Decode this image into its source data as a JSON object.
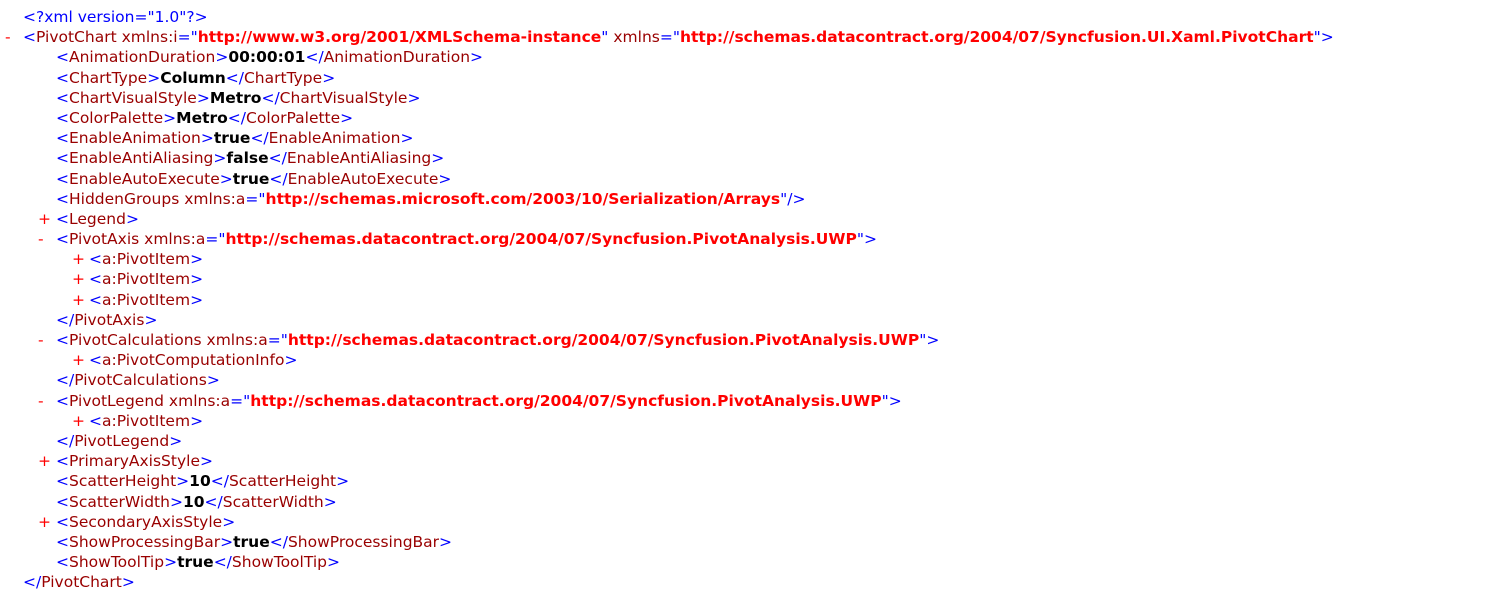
{
  "declaration": "<?xml version=\"1.0\"?>",
  "symbols": {
    "collapse": "-",
    "expand": "+"
  },
  "root": {
    "tag": "PivotChart",
    "attr1_name": "xmlns:i",
    "attr1_value": "http://www.w3.org/2001/XMLSchema-instance",
    "attr2_name": "xmlns",
    "attr2_value": "http://schemas.datacontract.org/2004/07/Syncfusion.UI.Xaml.PivotChart"
  },
  "simple_elements": [
    {
      "tag": "AnimationDuration",
      "value": "00:00:01"
    },
    {
      "tag": "ChartType",
      "value": "Column"
    },
    {
      "tag": "ChartVisualStyle",
      "value": "Metro"
    },
    {
      "tag": "ColorPalette",
      "value": "Metro"
    },
    {
      "tag": "EnableAnimation",
      "value": "true"
    },
    {
      "tag": "EnableAntiAliasing",
      "value": "false"
    },
    {
      "tag": "EnableAutoExecute",
      "value": "true"
    }
  ],
  "hidden_groups": {
    "tag": "HiddenGroups",
    "attr_name": "xmlns:a",
    "attr_value": "http://schemas.microsoft.com/2003/10/Serialization/Arrays"
  },
  "legend": {
    "tag": "Legend"
  },
  "pivot_axis": {
    "tag": "PivotAxis",
    "attr_name": "xmlns:a",
    "attr_value": "http://schemas.datacontract.org/2004/07/Syncfusion.PivotAnalysis.UWP",
    "children": [
      "a:PivotItem",
      "a:PivotItem",
      "a:PivotItem"
    ]
  },
  "pivot_calculations": {
    "tag": "PivotCalculations",
    "attr_name": "xmlns:a",
    "attr_value": "http://schemas.datacontract.org/2004/07/Syncfusion.PivotAnalysis.UWP",
    "children": [
      "a:PivotComputationInfo"
    ]
  },
  "pivot_legend": {
    "tag": "PivotLegend",
    "attr_name": "xmlns:a",
    "attr_value": "http://schemas.datacontract.org/2004/07/Syncfusion.PivotAnalysis.UWP",
    "children": [
      "a:PivotItem"
    ]
  },
  "primary_axis_style": {
    "tag": "PrimaryAxisStyle"
  },
  "scatter_elements": [
    {
      "tag": "ScatterHeight",
      "value": "10"
    },
    {
      "tag": "ScatterWidth",
      "value": "10"
    }
  ],
  "secondary_axis_style": {
    "tag": "SecondaryAxisStyle"
  },
  "tail_elements": [
    {
      "tag": "ShowProcessingBar",
      "value": "true"
    },
    {
      "tag": "ShowToolTip",
      "value": "true"
    }
  ],
  "colors": {
    "bracket": "#0000ff",
    "tag_name": "#990000",
    "attr_value": "#ff0000",
    "toggle": "#ff0000",
    "text": "#000000"
  }
}
